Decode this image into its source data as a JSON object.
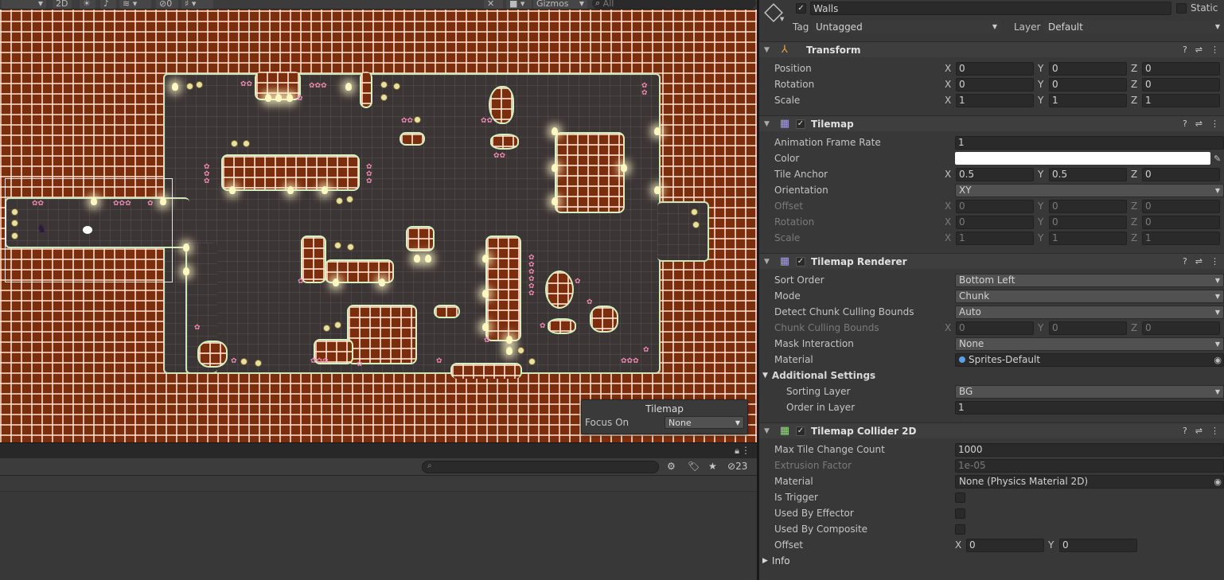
{
  "scene": {
    "toolbar": {
      "mode_2d": "2D",
      "hidden_count": "0",
      "gizmos": "Gizmos",
      "search_placeholder": "All"
    },
    "tilemap_overlay": {
      "title": "Tilemap",
      "focus_label": "Focus On",
      "focus_value": "None"
    }
  },
  "console": {
    "search_placeholder": "",
    "hidden_count": "23"
  },
  "inspector": {
    "object_name": "Walls",
    "static_label": "Static",
    "tag_label": "Tag",
    "tag_value": "Untagged",
    "layer_label": "Layer",
    "layer_value": "Default",
    "transform": {
      "title": "Transform",
      "position": {
        "label": "Position",
        "x": "0",
        "y": "0",
        "z": "0"
      },
      "rotation": {
        "label": "Rotation",
        "x": "0",
        "y": "0",
        "z": "0"
      },
      "scale": {
        "label": "Scale",
        "x": "1",
        "y": "1",
        "z": "1"
      }
    },
    "tilemap": {
      "title": "Tilemap",
      "anim_rate_label": "Animation Frame Rate",
      "anim_rate": "1",
      "color_label": "Color",
      "color_value": "#ffffff",
      "tile_anchor_label": "Tile Anchor",
      "tile_anchor": {
        "x": "0.5",
        "y": "0.5",
        "z": "0"
      },
      "orientation_label": "Orientation",
      "orientation": "XY",
      "offset_label": "Offset",
      "offset": {
        "x": "0",
        "y": "0",
        "z": "0"
      },
      "rotation_label": "Rotation",
      "rotation": {
        "x": "0",
        "y": "0",
        "z": "0"
      },
      "scale_label": "Scale",
      "scale": {
        "x": "1",
        "y": "1",
        "z": "1"
      }
    },
    "renderer": {
      "title": "Tilemap Renderer",
      "sort_order_label": "Sort Order",
      "sort_order": "Bottom Left",
      "mode_label": "Mode",
      "mode": "Chunk",
      "detect_label": "Detect Chunk Culling Bounds",
      "detect": "Auto",
      "chunk_bounds_label": "Chunk Culling Bounds",
      "chunk_bounds": {
        "x": "0",
        "y": "0",
        "z": "0"
      },
      "mask_label": "Mask Interaction",
      "mask": "None",
      "material_label": "Material",
      "material": "Sprites-Default",
      "additional": "Additional Settings",
      "sorting_layer_label": "Sorting Layer",
      "sorting_layer": "BG",
      "order_label": "Order in Layer",
      "order": "1"
    },
    "collider": {
      "title": "Tilemap Collider 2D",
      "max_tile_label": "Max Tile Change Count",
      "max_tile": "1000",
      "extrusion_label": "Extrusion Factor",
      "extrusion": "1e-05",
      "material_label": "Material",
      "material": "None (Physics Material 2D)",
      "trigger_label": "Is Trigger",
      "effector_label": "Used By Effector",
      "composite_label": "Used By Composite",
      "offset_label": "Offset",
      "offset": {
        "x": "0",
        "y": "0"
      },
      "info_label": "Info"
    }
  }
}
